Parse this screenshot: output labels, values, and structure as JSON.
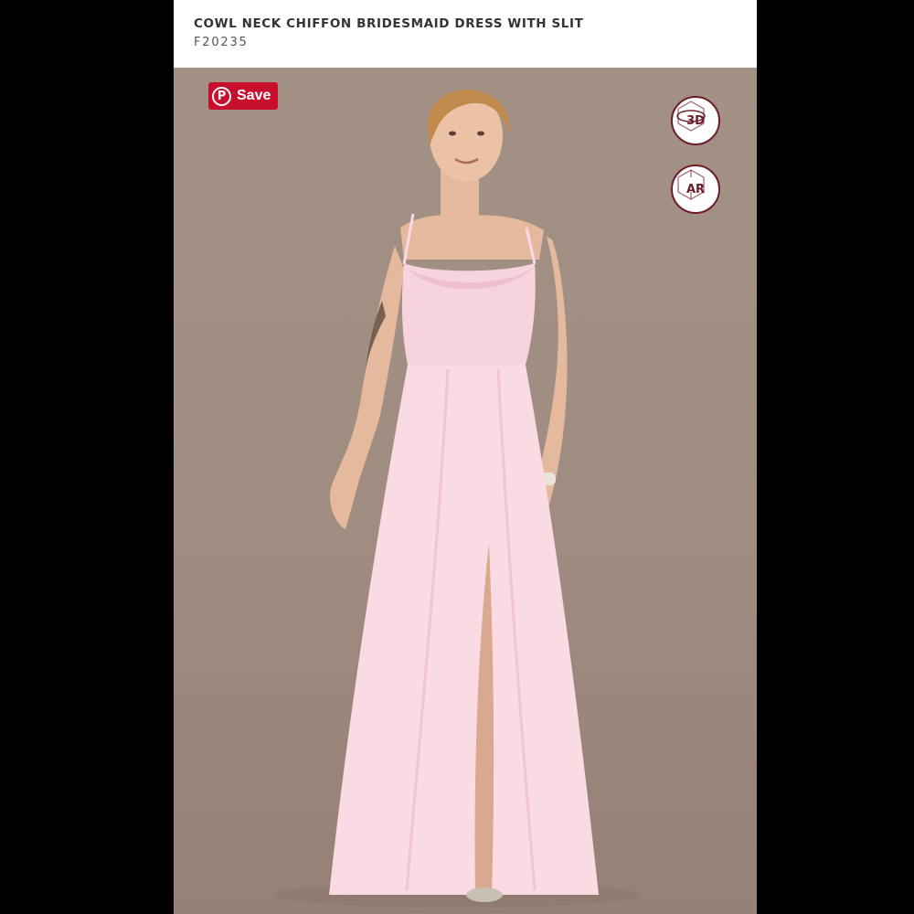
{
  "product": {
    "title": "COWL NECK CHIFFON BRIDESMAID DRESS WITH SLIT",
    "sku": "F20235"
  },
  "photo_actions": {
    "save_label": "Save",
    "three_d_label": "3D",
    "ar_label": "AR"
  },
  "icons": {
    "save": "pinterest-icon",
    "three_d": "cube-3d-icon",
    "ar": "cube-ar-icon"
  },
  "colors": {
    "save_button": "#c8102e",
    "accent": "#6b1d2a",
    "dress": "#fadbe3",
    "backdrop": "#a08c80"
  }
}
